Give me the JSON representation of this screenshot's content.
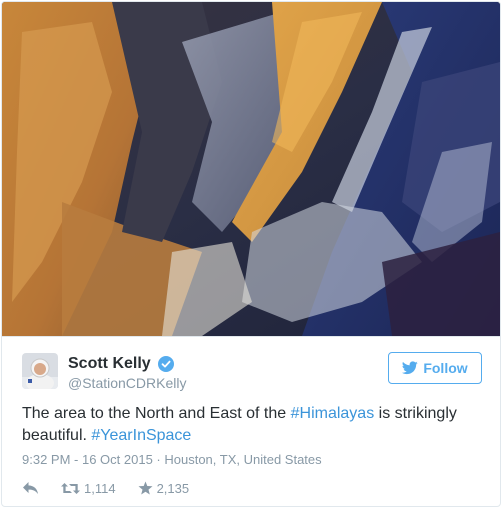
{
  "tweet": {
    "author": {
      "display_name": "Scott Kelly",
      "handle": "@StationCDRKelly",
      "verified": true
    },
    "follow_label": "Follow",
    "text": {
      "part1": "The area to the North and East of the ",
      "tag1": "#Himalayas",
      "part2": " is strikingly beautiful. ",
      "tag2": "#YearInSpace"
    },
    "timestamp": "9:32 PM - 16 Oct 2015",
    "separator": " · ",
    "location": "Houston, TX, United States",
    "retweets": "1,114",
    "likes": "2,135"
  },
  "colors": {
    "link": "#3b94d9",
    "brand": "#55acee",
    "muted": "#8899a6"
  },
  "icons": [
    "verified-icon",
    "twitter-bird-icon",
    "reply-icon",
    "retweet-icon",
    "star-icon"
  ]
}
